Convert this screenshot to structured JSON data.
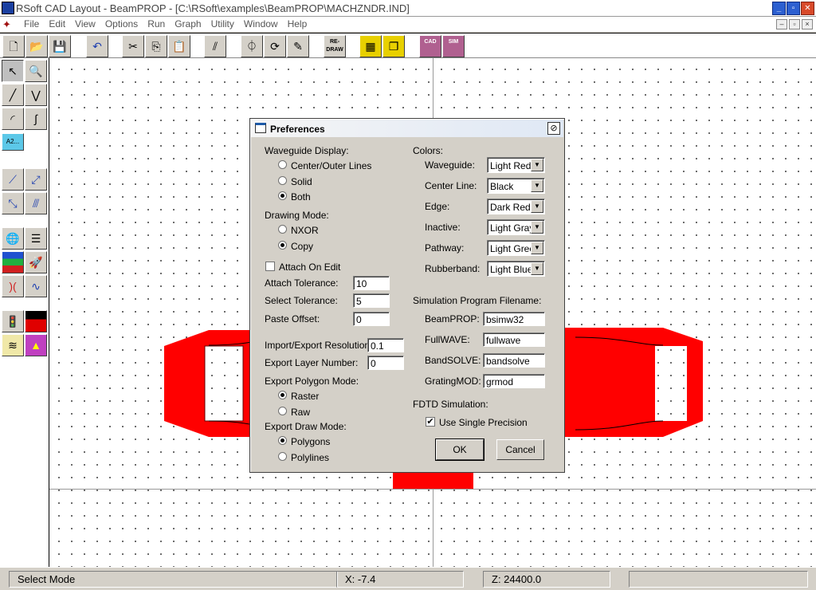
{
  "window": {
    "title": "RSoft CAD Layout - BeamPROP - [C:\\RSoft\\examples\\BeamPROP\\MACHZNDR.IND]"
  },
  "menu": [
    "File",
    "Edit",
    "View",
    "Options",
    "Run",
    "Graph",
    "Utility",
    "Window",
    "Help"
  ],
  "toolbar": {
    "redraw_label": "RE-DRAW",
    "cad_label": "CAD",
    "sim_label": "SIM"
  },
  "palette": {
    "a2_label": "A2..."
  },
  "status": {
    "mode": "Select Mode",
    "x": "X: -7.4",
    "z": "Z: 24400.0",
    "extra": ""
  },
  "dialog": {
    "title": "Preferences",
    "waveguide_display": {
      "label": "Waveguide Display:",
      "options": [
        "Center/Outer Lines",
        "Solid",
        "Both"
      ],
      "selected": 2
    },
    "drawing_mode": {
      "label": "Drawing Mode:",
      "options": [
        "NXOR",
        "Copy"
      ],
      "selected": 1
    },
    "attach_on_edit": {
      "label": "Attach On Edit",
      "checked": false
    },
    "attach_tolerance": {
      "label": "Attach Tolerance:",
      "value": "10"
    },
    "select_tolerance": {
      "label": "Select Tolerance:",
      "value": "5"
    },
    "paste_offset": {
      "label": "Paste Offset:",
      "value": "0"
    },
    "import_export_resolution": {
      "label": "Import/Export Resolution:",
      "value": "0.1"
    },
    "export_layer_number": {
      "label": "Export Layer Number:",
      "value": "0"
    },
    "export_polygon_mode": {
      "label": "Export Polygon Mode:",
      "options": [
        "Raster",
        "Raw"
      ],
      "selected": 0
    },
    "export_draw_mode": {
      "label": "Export Draw Mode:",
      "options": [
        "Polygons",
        "Polylines"
      ],
      "selected": 0
    },
    "colors": {
      "label": "Colors:",
      "items": [
        {
          "label": "Waveguide:",
          "value": "Light Red"
        },
        {
          "label": "Center Line:",
          "value": "Black"
        },
        {
          "label": "Edge:",
          "value": "Dark Red"
        },
        {
          "label": "Inactive:",
          "value": "Light Gray"
        },
        {
          "label": "Pathway:",
          "value": "Light Green"
        },
        {
          "label": "Rubberband:",
          "value": "Light Blue"
        }
      ]
    },
    "sim_program": {
      "label": "Simulation Program Filename:",
      "items": [
        {
          "label": "BeamPROP:",
          "value": "bsimw32"
        },
        {
          "label": "FullWAVE:",
          "value": "fullwave"
        },
        {
          "label": "BandSOLVE:",
          "value": "bandsolve"
        },
        {
          "label": "GratingMOD:",
          "value": "grmod"
        }
      ]
    },
    "fdtd": {
      "label": "FDTD Simulation:",
      "single_precision_label": "Use Single Precision",
      "checked": true
    },
    "ok_label": "OK",
    "cancel_label": "Cancel"
  },
  "colors": {
    "waveguide": "#ff0000",
    "title_accent": "#1e5aa8"
  }
}
